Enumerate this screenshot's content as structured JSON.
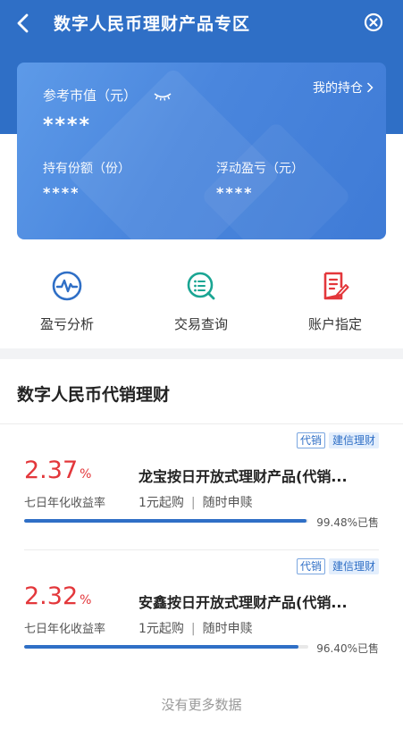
{
  "header": {
    "title": "数字人民币理财产品专区"
  },
  "card": {
    "market_value_label": "参考市值（元）",
    "market_value": "****",
    "my_holdings": "我的持仓",
    "shares_label": "持有份额（份）",
    "shares_value": "****",
    "pnl_label": "浮动盈亏（元）",
    "pnl_value": "****"
  },
  "actions": [
    {
      "label": "盈亏分析",
      "icon": "pulse-chart-icon",
      "color": "#2f6fc6"
    },
    {
      "label": "交易查询",
      "icon": "search-list-icon",
      "color": "#1aa593"
    },
    {
      "label": "账户指定",
      "icon": "document-edit-icon",
      "color": "#e3373b"
    }
  ],
  "section": {
    "title": "数字人民币代销理财"
  },
  "products": [
    {
      "tag1": "代销",
      "tag2": "建信理财",
      "rate": "2.37",
      "rate_unit": "%",
      "rate_label": "七日年化收益率",
      "name": "龙宝按日开放式理财产品(代销...",
      "min": "1元起购",
      "redeem": "随时申赎",
      "sold_pct": 0.9948,
      "sold_text": "99.48%已售"
    },
    {
      "tag1": "代销",
      "tag2": "建信理财",
      "rate": "2.32",
      "rate_unit": "%",
      "rate_label": "七日年化收益率",
      "name": "安鑫按日开放式理财产品(代销...",
      "min": "1元起购",
      "redeem": "随时申赎",
      "sold_pct": 0.964,
      "sold_text": "96.40%已售"
    }
  ],
  "footer": {
    "no_more": "没有更多数据"
  },
  "colors": {
    "brand_blue": "#2f6fc6",
    "rate_red": "#e3373b"
  }
}
